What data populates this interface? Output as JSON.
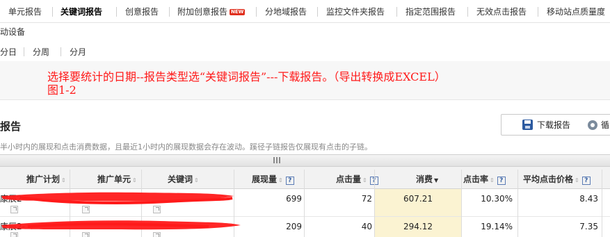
{
  "tabs": [
    {
      "label": "单元报告",
      "active": false
    },
    {
      "label": "关键词报告",
      "active": true
    },
    {
      "label": "创意报告",
      "active": false
    },
    {
      "label": "附加创意报告",
      "active": false,
      "badge": "NEW"
    },
    {
      "label": "分地域报告",
      "active": false
    },
    {
      "label": "监控文件夹报告",
      "active": false
    },
    {
      "label": "指定范围报告",
      "active": false
    },
    {
      "label": "无效点击报告",
      "active": false
    },
    {
      "label": "移动站点质量度",
      "active": false
    }
  ],
  "device_label": "动设备",
  "period": [
    "分日",
    "分周",
    "分月"
  ],
  "annotation": {
    "line1": "选择要统计的日期--报告类型选“关键词报告”---下载报告。（导出转换成EXCEL）",
    "line2": "图1-2"
  },
  "report": {
    "title": "报告",
    "hint": "半小时内的展现和点击消费数据，且最近1小时内的展现数据会存在波动。蹊径子链报告仅展现有点击的子链。",
    "download_label": "下载报告",
    "other_label": "循"
  },
  "table": {
    "columns": {
      "plan": "推广计划",
      "unit": "推广单元",
      "keyword": "关键词",
      "impressions": "展现量",
      "clicks": "点击量",
      "cost": "消费",
      "ctr": "点击率",
      "cpc": "平均点击价格"
    },
    "help_glyph": "?",
    "rows": [
      {
        "left_text": "康辰2-",
        "impressions": "699",
        "clicks": "72",
        "cost": "607.21",
        "ctr": "10.30%",
        "cpc": "8.43"
      },
      {
        "left_text": "康辰2-",
        "impressions": "209",
        "clicks": "40",
        "cost": "294.12",
        "ctr": "19.14%",
        "cpc": "7.35"
      }
    ]
  },
  "colors": {
    "annotation": "#ff1a1a",
    "redaction": "#ff1a1a",
    "cost_highlight": "#fbf3d2",
    "new_badge": "#e0301e"
  }
}
